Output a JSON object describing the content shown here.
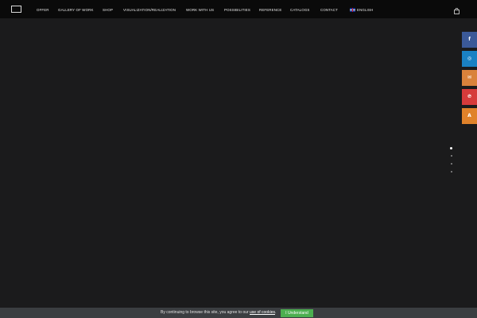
{
  "nav": {
    "items": [
      {
        "label": "OFFER"
      },
      {
        "label": "GALLERY OF WORK"
      },
      {
        "label": "SHOP"
      },
      {
        "label": "VISUALIZATION/REALIZATION"
      },
      {
        "label": "WORK WITH US"
      },
      {
        "label": "POSSIBILITIES"
      },
      {
        "label": "REFERENCE"
      },
      {
        "label": "CATALOGS"
      },
      {
        "label": "CONTACT"
      }
    ],
    "language": {
      "label": "ENGLISH",
      "flag": "uk-flag-icon"
    }
  },
  "header": {
    "cart_icon": "shopping-bag-icon"
  },
  "social": [
    {
      "network": "facebook",
      "icon": "facebook-icon",
      "glyph": "f",
      "color": "#3b5998"
    },
    {
      "network": "instagram",
      "icon": "instagram-icon",
      "glyph": "◎",
      "color": "#1a81c3"
    },
    {
      "network": "email",
      "icon": "email-icon",
      "glyph": "✉",
      "color": "#d9823b"
    },
    {
      "network": "pinterest",
      "icon": "pinterest-icon",
      "glyph": "℗",
      "color": "#d63b3b"
    },
    {
      "network": "other",
      "icon": "a-icon",
      "glyph": "A",
      "color": "#e0822a"
    }
  ],
  "slider": {
    "total": 4,
    "active": 1
  },
  "cookie": {
    "text_before": "By continuing to browse this site, you agree to our ",
    "link_text": "use of cookies",
    "text_after": ".",
    "button_label": "I Understand",
    "button_color": "#4caf50"
  }
}
